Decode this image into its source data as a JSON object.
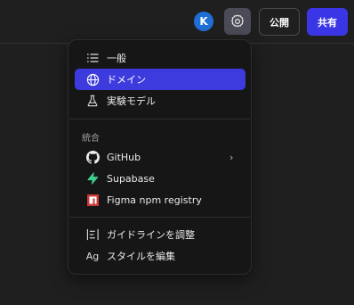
{
  "header": {
    "avatar_initial": "K",
    "publish_label": "公開",
    "share_label": "共有",
    "colors": {
      "avatar": "#1f6fd6",
      "settings_active_bg": "#4a4b56",
      "share_bg": "#3a36e6"
    }
  },
  "menu": {
    "general_items": [
      {
        "label": "一般",
        "icon": "list-icon"
      },
      {
        "label": "ドメイン",
        "icon": "globe-icon",
        "active": true
      },
      {
        "label": "実験モデル",
        "icon": "flask-icon"
      }
    ],
    "integrations_label": "統合",
    "integration_items": [
      {
        "label": "GitHub",
        "icon": "github-icon",
        "has_submenu": true
      },
      {
        "label": "Supabase",
        "icon": "supabase-icon"
      },
      {
        "label": "Figma npm registry",
        "icon": "npm-icon"
      }
    ],
    "bottom_items": [
      {
        "label": "ガイドラインを調整",
        "icon": "guidelines-icon"
      },
      {
        "label": "スタイルを編集",
        "icon": "typography-icon",
        "icon_text": "Ag"
      }
    ],
    "submenu_indicator": "›",
    "colors": {
      "active_bg": "#3d3bde",
      "supabase": "#3ecf8e",
      "npm": "#cb3837"
    }
  }
}
